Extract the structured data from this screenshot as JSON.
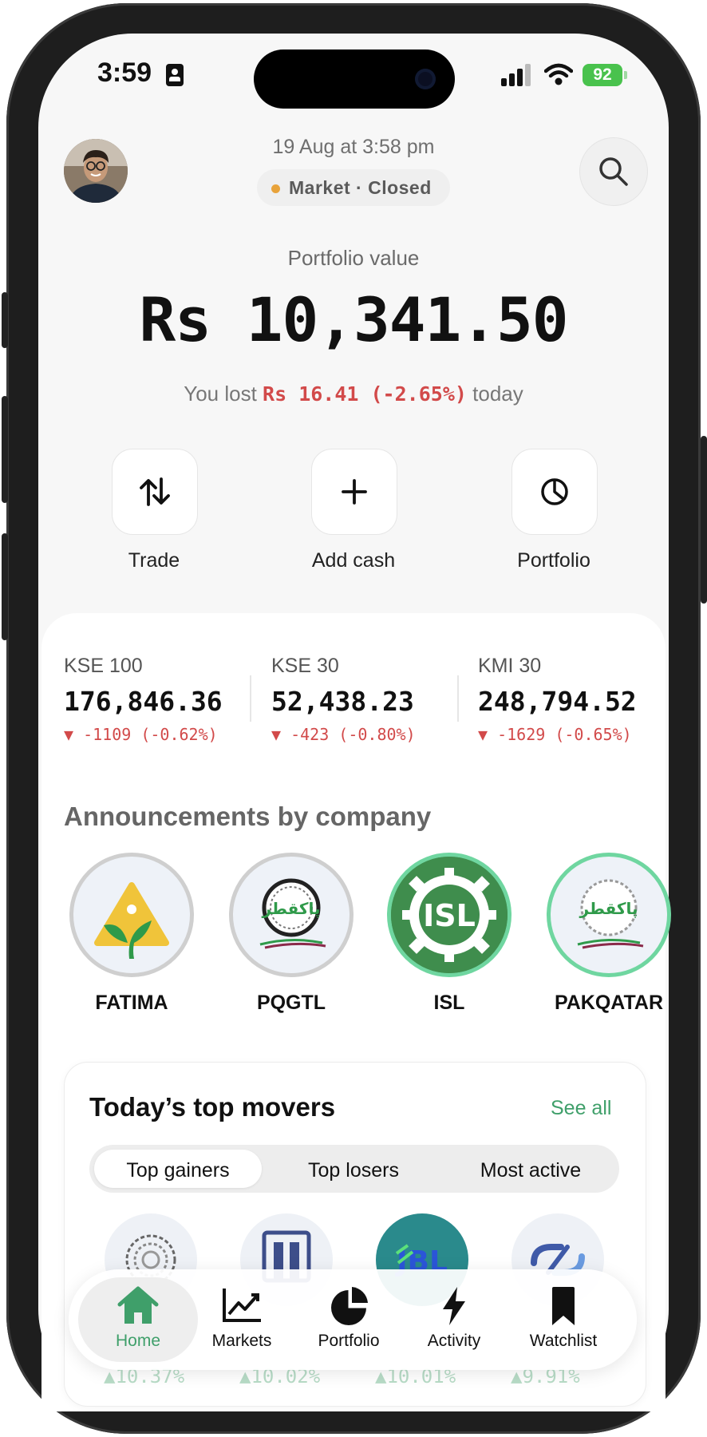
{
  "status_bar": {
    "time": "3:59",
    "battery": "92"
  },
  "header": {
    "date": "19 Aug at 3:58 pm",
    "market_status": "Market · Closed"
  },
  "portfolio": {
    "label": "Portfolio value",
    "value": "Rs 10,341.50",
    "change_prefix": "You lost ",
    "change_amount": "Rs 16.41 (-2.65%)",
    "change_suffix": " today"
  },
  "actions": [
    {
      "label": "Trade",
      "icon": "trade-arrows-icon"
    },
    {
      "label": "Add cash",
      "icon": "plus-icon"
    },
    {
      "label": "Portfolio",
      "icon": "pie-chart-icon"
    }
  ],
  "indices": [
    {
      "name": "KSE 100",
      "value": "176,846.36",
      "change": "▼ -1109 (-0.62%)"
    },
    {
      "name": "KSE 30",
      "value": "52,438.23",
      "change": "▼ -423 (-0.80%)"
    },
    {
      "name": "KMI 30",
      "value": "248,794.52",
      "change": "▼ -1629 (-0.65%)"
    }
  ],
  "announcements": {
    "title": "Announcements by company",
    "companies": [
      "FATIMA",
      "PQGTL",
      "ISL",
      "PAKQATAR"
    ]
  },
  "movers": {
    "title": "Today’s top movers",
    "see_all": "See all",
    "tabs": [
      "Top gainers",
      "Top losers",
      "Most active"
    ],
    "selected_tab": "Top gainers",
    "items": [
      {
        "pct": "▲10.37%"
      },
      {
        "pct": "▲10.02%"
      },
      {
        "pct": "▲10.01%"
      },
      {
        "pct": "▲9.91%"
      }
    ]
  },
  "nav": {
    "items": [
      "Home",
      "Markets",
      "Portfolio",
      "Activity",
      "Watchlist"
    ],
    "active": "Home"
  },
  "colors": {
    "accent_green": "#3f9f6a",
    "loss_red": "#d24a4a",
    "market_dot": "#e8a33b"
  }
}
